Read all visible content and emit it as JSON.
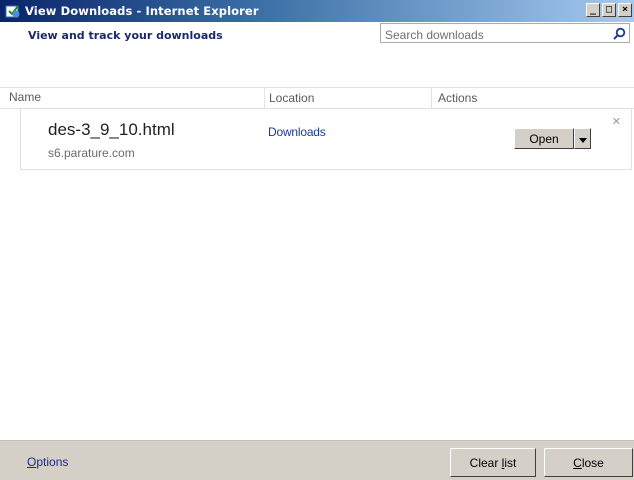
{
  "window": {
    "title": "View Downloads - Internet Explorer",
    "controls": [
      "minimize",
      "maximize",
      "close"
    ]
  },
  "header": {
    "title": "View and track your downloads",
    "search_placeholder": "Search downloads",
    "search_icon": "search-icon"
  },
  "columns": {
    "name": "Name",
    "location": "Location",
    "actions": "Actions"
  },
  "downloads": [
    {
      "file_name": "des-3_9_10.html",
      "source": "s6.parature.com",
      "location": "Downloads",
      "action_label": "Open"
    }
  ],
  "footer": {
    "options_label": "Options",
    "clear_list_label": "Clear list",
    "close_label": "Close"
  },
  "colors": {
    "titlebar_start": "#0a246a",
    "titlebar_end": "#a6caf0",
    "link": "#1e3a8a",
    "footer_bg": "#d4d0c8"
  }
}
